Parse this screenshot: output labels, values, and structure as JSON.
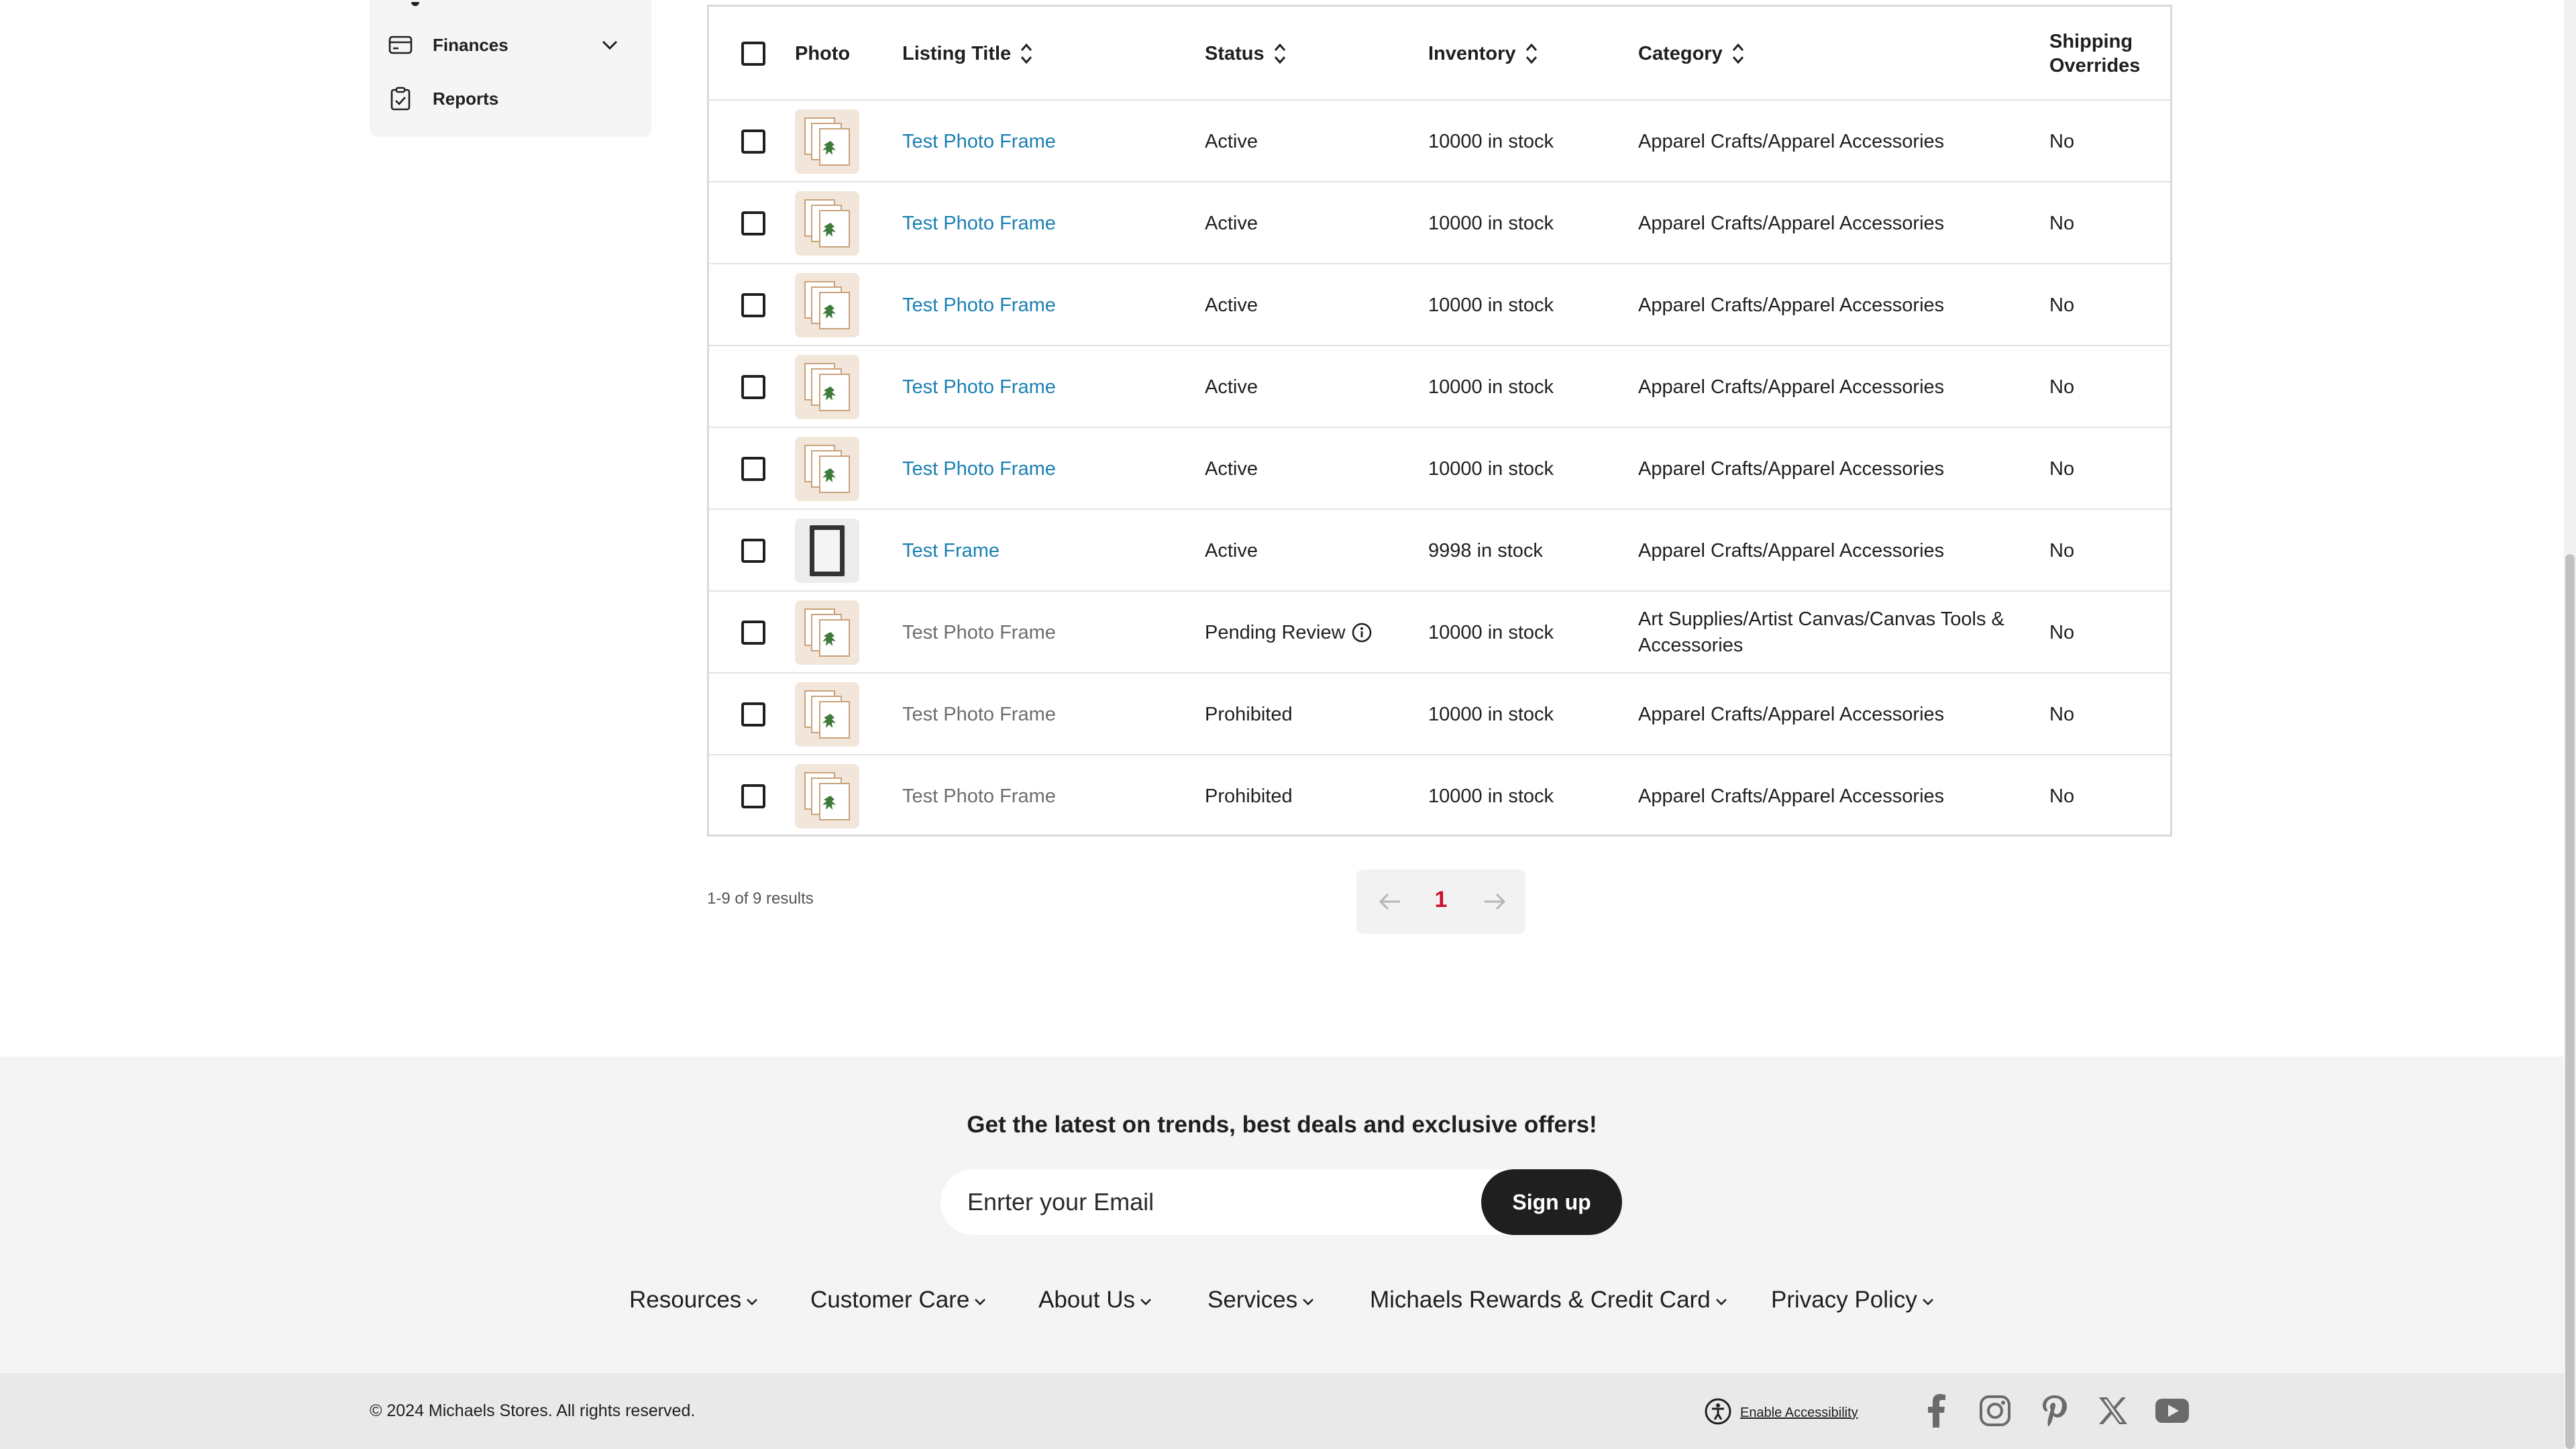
{
  "sidebar": {
    "items": [
      {
        "label": "Finances",
        "icon": "credit-card-icon",
        "expandable": true
      },
      {
        "label": "Reports",
        "icon": "clipboard-check-icon",
        "expandable": false
      }
    ]
  },
  "table": {
    "columns": {
      "photo": "Photo",
      "title": "Listing Title",
      "status": "Status",
      "inventory": "Inventory",
      "category": "Category",
      "shipping": "Shipping Overrides"
    },
    "rows": [
      {
        "title": "Test Photo Frame",
        "status": "Active",
        "inventory": "10000 in stock",
        "category": "Apparel Crafts/Apparel Accessories",
        "shipping": "No",
        "linked": true,
        "thumb": "photo-frame-stack"
      },
      {
        "title": "Test Photo Frame",
        "status": "Active",
        "inventory": "10000 in stock",
        "category": "Apparel Crafts/Apparel Accessories",
        "shipping": "No",
        "linked": true,
        "thumb": "photo-frame-stack"
      },
      {
        "title": "Test Photo Frame",
        "status": "Active",
        "inventory": "10000 in stock",
        "category": "Apparel Crafts/Apparel Accessories",
        "shipping": "No",
        "linked": true,
        "thumb": "photo-frame-stack"
      },
      {
        "title": "Test Photo Frame",
        "status": "Active",
        "inventory": "10000 in stock",
        "category": "Apparel Crafts/Apparel Accessories",
        "shipping": "No",
        "linked": true,
        "thumb": "photo-frame-stack"
      },
      {
        "title": "Test Photo Frame",
        "status": "Active",
        "inventory": "10000 in stock",
        "category": "Apparel Crafts/Apparel Accessories",
        "shipping": "No",
        "linked": true,
        "thumb": "photo-frame-stack"
      },
      {
        "title": "Test Frame",
        "status": "Active",
        "inventory": "9998 in stock",
        "category": "Apparel Crafts/Apparel Accessories",
        "shipping": "No",
        "linked": true,
        "thumb": "black-frame"
      },
      {
        "title": "Test Photo Frame",
        "status": "Pending Review",
        "inventory": "10000 in stock",
        "category": "Art Supplies/Artist Canvas/Canvas Tools & Accessories",
        "shipping": "No",
        "linked": false,
        "thumb": "photo-frame-stack",
        "info": true
      },
      {
        "title": "Test Photo Frame",
        "status": "Prohibited",
        "inventory": "10000 in stock",
        "category": "Apparel Crafts/Apparel Accessories",
        "shipping": "No",
        "linked": false,
        "thumb": "photo-frame-stack"
      },
      {
        "title": "Test Photo Frame",
        "status": "Prohibited",
        "inventory": "10000 in stock",
        "category": "Apparel Crafts/Apparel Accessories",
        "shipping": "No",
        "linked": false,
        "thumb": "photo-frame-stack"
      }
    ]
  },
  "results": "1-9 of 9 results",
  "pagination": {
    "current_page": "1"
  },
  "footer": {
    "newsletter_title": "Get the latest on trends, best deals and exclusive offers!",
    "email_placeholder": "Enrter your Email",
    "signup_label": "Sign up",
    "links": [
      "Resources",
      "Customer Care",
      "About Us",
      "Services",
      "Michaels Rewards & Credit Card",
      "Privacy Policy"
    ],
    "copyright": "© 2024 Michaels Stores. All rights reserved.",
    "accessibility_label": "Enable Accessibility",
    "social": [
      "facebook-icon",
      "instagram-icon",
      "pinterest-icon",
      "x-icon",
      "youtube-icon"
    ]
  },
  "colors": {
    "link": "#1a7fb3",
    "page_active": "#c8102e",
    "button_dark": "#1f1f1f",
    "footer_bg": "#f4f4f4"
  }
}
